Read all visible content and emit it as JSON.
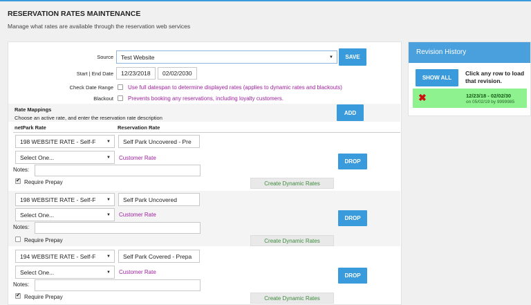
{
  "header": {
    "title": "RESERVATION RATES MAINTENANCE",
    "subtitle": "Manage what rates are available through the reservation web services"
  },
  "form": {
    "source_label": "Source",
    "source_value": "Test Website",
    "save_label": "SAVE",
    "dates_label": "Start | End Date",
    "start_date": "12/23/2018",
    "end_date": "02/02/2030",
    "check_range_label": "Check Date Range",
    "check_range_desc": "Use full datespan to determine displayed rates (applies to dynamic rates and blackouts)",
    "blackout_label": "Blackout",
    "blackout_desc": "Prevents booking any reservations, including loyalty customers.",
    "mappings_title": "Rate Mappings",
    "mappings_desc": "Choose an active rate, and enter the reservation rate description",
    "add_label": "ADD",
    "col_netpark": "netPark Rate",
    "col_reservation": "Reservation Rate"
  },
  "rates": [
    {
      "netpark_rate": "198 WEBSITE RATE - Self-F",
      "reservation_rate": "Self Park Uncovered - Pre",
      "secondary": "Select One...",
      "customer_rate": "Customer Rate",
      "notes_label": "Notes:",
      "prepay_label": "Require Prepay",
      "prepay_checked": true,
      "drop_label": "DROP",
      "dynamic_label": "Create Dynamic Rates"
    },
    {
      "netpark_rate": "198 WEBSITE RATE - Self-F",
      "reservation_rate": "Self Park Uncovered",
      "secondary": "Select One...",
      "customer_rate": "Customer Rate",
      "notes_label": "Notes:",
      "prepay_label": "Require Prepay",
      "prepay_checked": false,
      "drop_label": "DROP",
      "dynamic_label": "Create Dynamic Rates"
    },
    {
      "netpark_rate": "194 WEBSITE RATE - Self-F",
      "reservation_rate": "Self Park Covered - Prepa",
      "secondary": "Select One...",
      "customer_rate": "Customer Rate",
      "notes_label": "Notes:",
      "prepay_label": "Require Prepay",
      "prepay_checked": true,
      "drop_label": "DROP",
      "dynamic_label": "Create Dynamic Rates"
    }
  ],
  "revision": {
    "title": "Revision History",
    "show_all_label": "SHOW ALL",
    "hint": "Click any row to load that revision.",
    "entry_range": "12/23/18 - 02/02/30",
    "entry_meta": "on 05/02/19 by 9999985",
    "entry_icon": "close-icon",
    "entry_color": "#8ef28e"
  },
  "colors": {
    "accent": "#3a9bdc",
    "purple_text": "#a020a0",
    "green_text": "#3c8a3c"
  }
}
